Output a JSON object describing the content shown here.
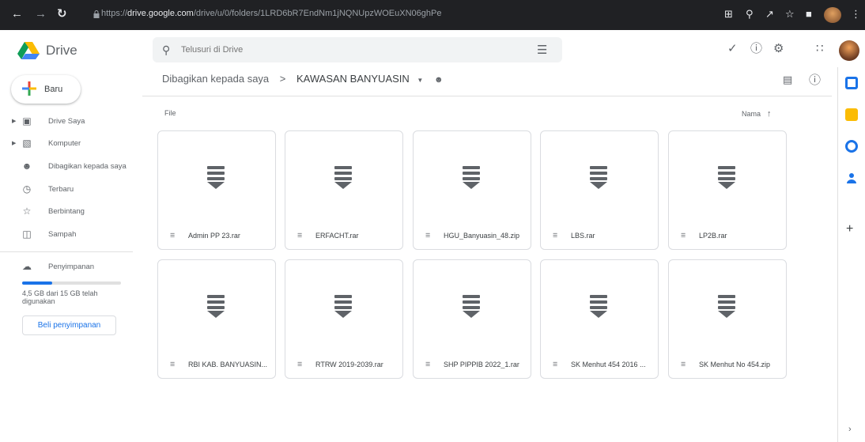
{
  "browser": {
    "url_prefix": "https://",
    "url_host": "drive.google.com",
    "url_path": "/drive/u/0/folders/1LRD6bR7EndNm1jNQNUpzWOEuXN06ghPe"
  },
  "app": {
    "name": "Drive"
  },
  "search": {
    "placeholder": "Telusuri di Drive"
  },
  "sidebar": {
    "new_label": "Baru",
    "items": [
      {
        "label": "Drive Saya",
        "icon": "drive-icon"
      },
      {
        "label": "Komputer",
        "icon": "computer-icon"
      },
      {
        "label": "Dibagikan kepada saya",
        "icon": "shared-icon"
      },
      {
        "label": "Terbaru",
        "icon": "clock-icon"
      },
      {
        "label": "Berbintang",
        "icon": "star-icon"
      },
      {
        "label": "Sampah",
        "icon": "trash-icon"
      }
    ],
    "storage": {
      "label": "Penyimpanan",
      "usage_text": "4,5 GB dari 15 GB telah digunakan",
      "used_fraction": 0.3,
      "buy_label": "Beli penyimpanan"
    }
  },
  "breadcrumb": {
    "parent": "Dibagikan kepada saya",
    "separator": ">",
    "current": "KAWASAN BANYUASIN"
  },
  "main": {
    "section_label": "File",
    "sort_label": "Nama",
    "files": [
      "Admin PP 23.rar",
      "ERFACHT.rar",
      "HGU_Banyuasin_48.zip",
      "LBS.rar",
      "LP2B.rar",
      "RBI KAB. BANYUASIN...",
      "RTRW 2019-2039.rar",
      "SHP PIPPIB 2022_1.rar",
      "SK Menhut 454 2016 ...",
      "SK Menhut No 454.zip"
    ]
  },
  "colors": {
    "accent": "#1a73e8",
    "chrome": "#202124",
    "search_bg": "#f1f3f4"
  }
}
